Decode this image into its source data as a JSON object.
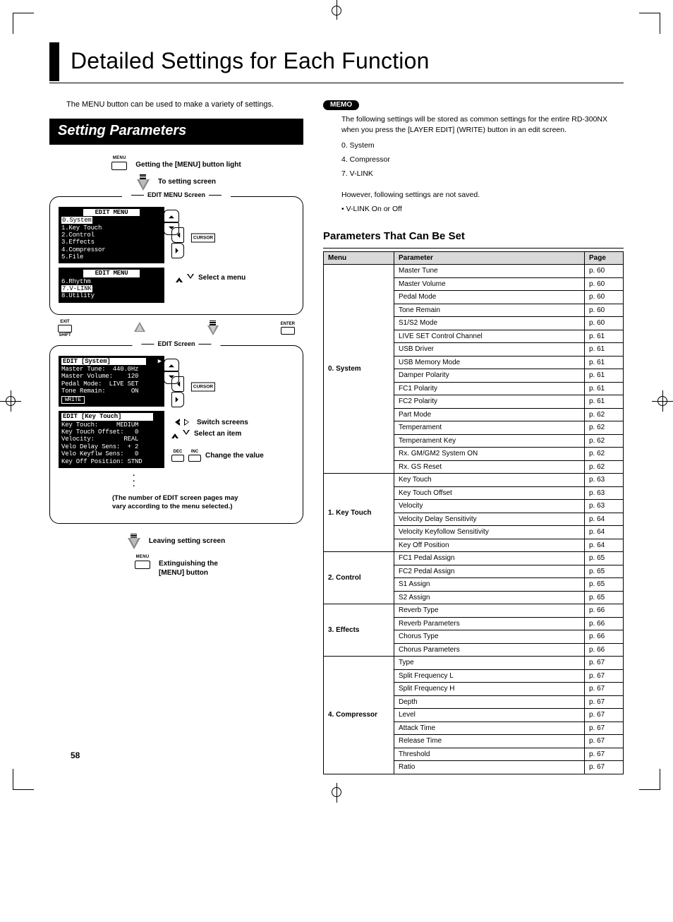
{
  "page": {
    "title": "Detailed Settings for Each Function",
    "number": "58"
  },
  "intro": "The MENU button can be used to make a variety of settings.",
  "section_heading": "Setting Parameters",
  "flow": {
    "menu_label": "MENU",
    "step_light": "Getting the [MENU] button light",
    "step_to_setting": "To setting screen",
    "edit_menu_title": "EDIT MENU Screen",
    "cursor_label": "CURSOR",
    "select_menu": "Select a menu",
    "exit_label": "EXIT",
    "shift_label": "SHIFT",
    "enter_label": "ENTER",
    "edit_title": "EDIT Screen",
    "switch_screens": "Switch screens",
    "select_item": "Select an item",
    "dec_label": "DEC",
    "inc_label": "INC",
    "change_value": "Change the value",
    "note1": "(The number of EDIT screen pages may",
    "note2": "vary according to the menu selected.)",
    "leaving": "Leaving setting screen",
    "extinguish1": "Extinguishing the",
    "extinguish2": "[MENU] button",
    "lcd1_title": "EDIT MENU",
    "lcd1_lines": [
      "0.System",
      "1.Key Touch",
      "2.Control",
      "3.Effects",
      "4.Compressor",
      "5.File"
    ],
    "lcd2_title": "EDIT MENU",
    "lcd2_lines": [
      "6.Rhythm",
      "7.V-LINK",
      "8.Utility"
    ],
    "lcd3_title": "EDIT [System]",
    "lcd3_lines": [
      "Master Tune:  440.0Hz",
      "Master Volume:    120",
      "Pedal Mode:  LIVE SET",
      "Tone Remain:       ON"
    ],
    "lcd3_write": "WRITE",
    "lcd4_title": "EDIT [Key Touch]",
    "lcd4_lines": [
      "Key Touch:     MEDIUM",
      "Key Touch Offset:   0",
      "Velocity:        REAL",
      "Velo Delay Sens:  + 2",
      "Velo Keyflw Sens:   0",
      "Key Off Position: STND"
    ]
  },
  "memo": {
    "badge": "MEMO",
    "body": "The following settings will be stored as common settings for the entire RD-300NX when you press the [LAYER EDIT] (WRITE) button in an edit screen.",
    "items": [
      "0. System",
      "4. Compressor",
      "7. V-LINK"
    ],
    "not_saved": "However, following settings are not saved.",
    "bullets": [
      "V-LINK On or Off"
    ]
  },
  "params": {
    "heading": "Parameters That Can Be Set",
    "headers": {
      "menu": "Menu",
      "parameter": "Parameter",
      "page": "Page"
    },
    "groups": [
      {
        "menu": "0. System",
        "rows": [
          {
            "p": "Master Tune",
            "pg": "p. 60"
          },
          {
            "p": "Master Volume",
            "pg": "p. 60"
          },
          {
            "p": "Pedal Mode",
            "pg": "p. 60"
          },
          {
            "p": "Tone Remain",
            "pg": "p. 60"
          },
          {
            "p": "S1/S2 Mode",
            "pg": "p. 60"
          },
          {
            "p": "LIVE SET Control Channel",
            "pg": "p. 61"
          },
          {
            "p": "USB Driver",
            "pg": "p. 61"
          },
          {
            "p": "USB Memory Mode",
            "pg": "p. 61"
          },
          {
            "p": "Damper Polarity",
            "pg": "p. 61"
          },
          {
            "p": "FC1 Polarity",
            "pg": "p. 61"
          },
          {
            "p": "FC2 Polarity",
            "pg": "p. 61"
          },
          {
            "p": "Part Mode",
            "pg": "p. 62"
          },
          {
            "p": "Temperament",
            "pg": "p. 62"
          },
          {
            "p": "Temperament Key",
            "pg": "p. 62"
          },
          {
            "p": "Rx. GM/GM2 System ON",
            "pg": "p. 62"
          },
          {
            "p": "Rx. GS Reset",
            "pg": "p. 62"
          }
        ]
      },
      {
        "menu": "1. Key Touch",
        "rows": [
          {
            "p": "Key Touch",
            "pg": "p. 63"
          },
          {
            "p": "Key Touch Offset",
            "pg": "p. 63"
          },
          {
            "p": "Velocity",
            "pg": "p. 63"
          },
          {
            "p": "Velocity Delay Sensitivity",
            "pg": "p. 64"
          },
          {
            "p": "Velocity Keyfollow Sensitivity",
            "pg": "p. 64"
          },
          {
            "p": "Key Off Position",
            "pg": "p. 64"
          }
        ]
      },
      {
        "menu": "2. Control",
        "rows": [
          {
            "p": "FC1 Pedal Assign",
            "pg": "p. 65"
          },
          {
            "p": "FC2 Pedal Assign",
            "pg": "p. 65"
          },
          {
            "p": "S1 Assign",
            "pg": "p. 65"
          },
          {
            "p": "S2 Assign",
            "pg": "p. 65"
          }
        ]
      },
      {
        "menu": "3. Effects",
        "rows": [
          {
            "p": "Reverb Type",
            "pg": "p. 66"
          },
          {
            "p": "Reverb Parameters",
            "pg": "p. 66"
          },
          {
            "p": "Chorus Type",
            "pg": "p. 66"
          },
          {
            "p": "Chorus Parameters",
            "pg": "p. 66"
          }
        ]
      },
      {
        "menu": "4. Compressor",
        "rows": [
          {
            "p": "Type",
            "pg": "p. 67"
          },
          {
            "p": "Split Frequency L",
            "pg": "p. 67"
          },
          {
            "p": "Split Frequency H",
            "pg": "p. 67"
          },
          {
            "p": "Depth",
            "pg": "p. 67"
          },
          {
            "p": "Level",
            "pg": "p. 67"
          },
          {
            "p": "Attack Time",
            "pg": "p. 67"
          },
          {
            "p": "Release Time",
            "pg": "p. 67"
          },
          {
            "p": "Threshold",
            "pg": "p. 67"
          },
          {
            "p": "Ratio",
            "pg": "p. 67"
          }
        ]
      }
    ]
  }
}
